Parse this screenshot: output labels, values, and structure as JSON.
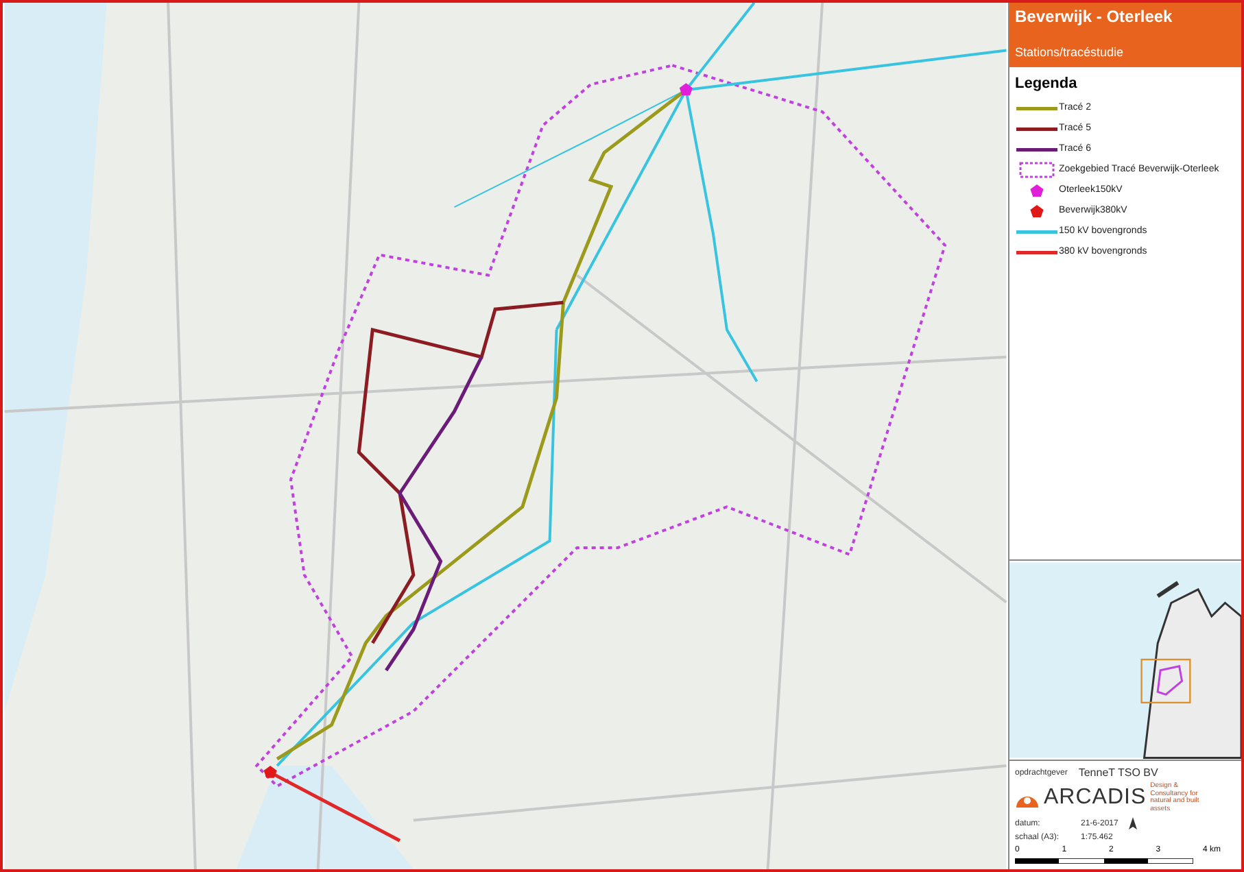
{
  "header": {
    "title": "Beverwijk - Oterleek",
    "subtitle": "Stations/tracéstudie"
  },
  "legend": {
    "title": "Legenda",
    "items": [
      {
        "label": "Tracé 2",
        "kind": "line",
        "color": "#9c9a1c"
      },
      {
        "label": "Tracé 5",
        "kind": "line",
        "color": "#8a1c22"
      },
      {
        "label": "Tracé 6",
        "kind": "line",
        "color": "#6a1c78"
      },
      {
        "label": "Zoekgebied Tracé Beverwijk-Oterleek",
        "kind": "area",
        "color": "#c040e0"
      },
      {
        "label": "Oterleek150kV",
        "kind": "station",
        "color": "#e020d8"
      },
      {
        "label": "Beverwijk380kV",
        "kind": "station",
        "color": "#e01818"
      },
      {
        "label": "150 kV bovengronds",
        "kind": "line",
        "color": "#38c4e0"
      },
      {
        "label": "380 kV bovengronds",
        "kind": "line",
        "color": "#e02828"
      }
    ]
  },
  "footer": {
    "client_label": "opdrachtgever",
    "client": "TenneT TSO BV",
    "logo": "ARCADIS",
    "tagline": "Design & Consultancy for natural and built assets",
    "date_label": "datum:",
    "date": "21-6-2017",
    "scale_label": "schaal (A3):",
    "scale": "1:75.462",
    "scale_ticks": [
      "0",
      "1",
      "2",
      "3",
      "4 km"
    ]
  }
}
